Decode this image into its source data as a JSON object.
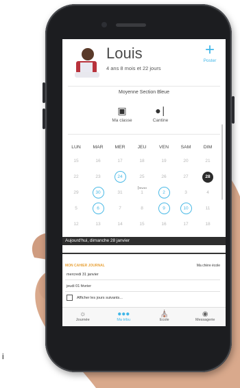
{
  "profile": {
    "name": "Louis",
    "age": "4 ans 8 mois et 22 jours",
    "post_label": "Poster",
    "post_icon": "plus-icon"
  },
  "class_name": "Moyenne Section Bleue",
  "quick_links": [
    {
      "label": "Ma classe",
      "icon": "classroom-icon"
    },
    {
      "label": "Cantine",
      "icon": "cutlery-icon"
    }
  ],
  "calendar": {
    "weekdays": [
      "LUN",
      "MAR",
      "MER",
      "JEU",
      "VEN",
      "SAM",
      "DIM"
    ],
    "weeks": [
      [
        {
          "d": "15"
        },
        {
          "d": "16"
        },
        {
          "d": "17"
        },
        {
          "d": "18"
        },
        {
          "d": "19"
        },
        {
          "d": "20"
        },
        {
          "d": "21"
        }
      ],
      [
        {
          "d": "22"
        },
        {
          "d": "23"
        },
        {
          "d": "24",
          "circle": true
        },
        {
          "d": "25"
        },
        {
          "d": "26"
        },
        {
          "d": "27"
        },
        {
          "d": "28",
          "today": true
        }
      ],
      [
        {
          "d": "29"
        },
        {
          "d": "30",
          "circle": true
        },
        {
          "d": "31"
        },
        {
          "d": "1",
          "note": "février"
        },
        {
          "d": "2",
          "circle": true
        },
        {
          "d": "3"
        },
        {
          "d": "4"
        }
      ],
      [
        {
          "d": "5"
        },
        {
          "d": "6",
          "circle": true
        },
        {
          "d": "7"
        },
        {
          "d": "8"
        },
        {
          "d": "9",
          "circle": true
        },
        {
          "d": "10",
          "circle": true
        },
        {
          "d": "11"
        }
      ],
      [
        {
          "d": "12"
        },
        {
          "d": "13"
        },
        {
          "d": "14"
        },
        {
          "d": "15"
        },
        {
          "d": "16"
        },
        {
          "d": "17"
        },
        {
          "d": "18"
        }
      ]
    ]
  },
  "today_banner": "Aujourd'hui, dimanche 28 janvier",
  "journal": {
    "title": "MON CAHIER JOURNAL",
    "right_label": "Ma chère école",
    "items": [
      "mercredi 31 janvier",
      "jeudi 01 février"
    ],
    "show_more": "Afficher les jours suivants..."
  },
  "tabs": [
    {
      "label": "Journée",
      "icon": "sun-icon",
      "active": false
    },
    {
      "label": "Ma tribu",
      "icon": "family-icon",
      "active": true
    },
    {
      "label": "Ecole",
      "icon": "school-icon",
      "active": false
    },
    {
      "label": "Messagerie",
      "icon": "chat-icon",
      "active": false
    }
  ],
  "colors": {
    "accent": "#3fb6e8",
    "journal_header": "#e8a23a",
    "banner": "#2e2e2e"
  },
  "stray_text": "i"
}
